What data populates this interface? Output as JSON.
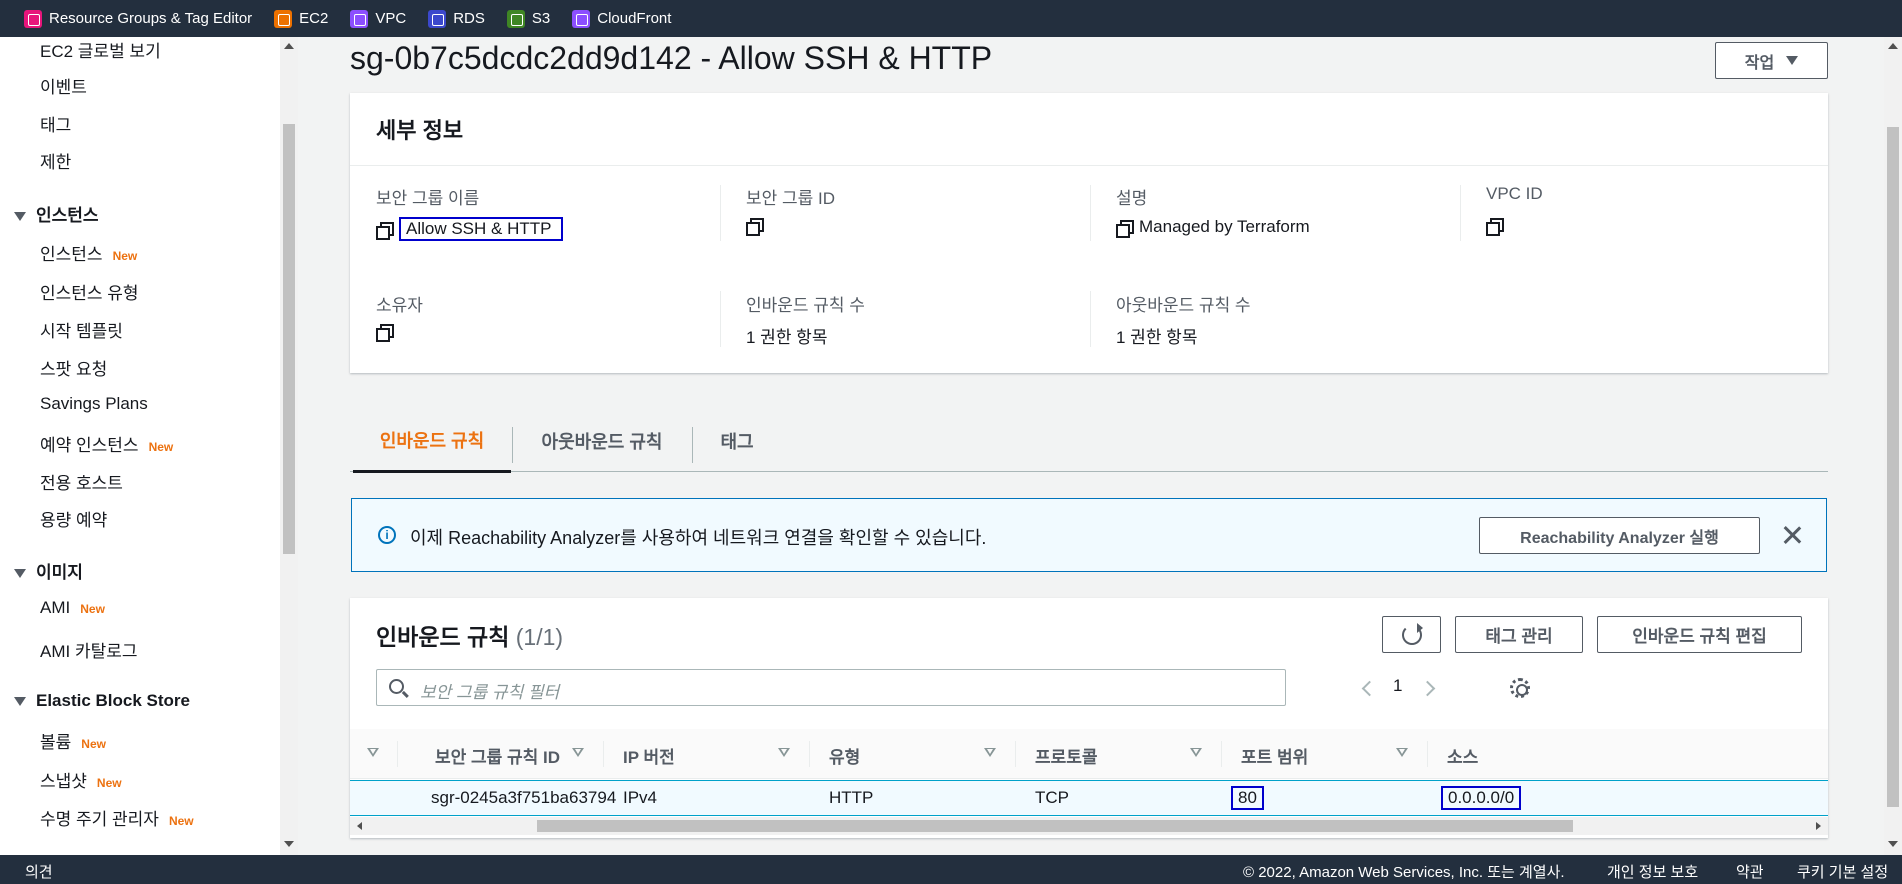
{
  "topbar": {
    "favorites": [
      {
        "label": "Resource Groups & Tag Editor",
        "color": "#e7157b"
      },
      {
        "label": "EC2",
        "color": "#ed7100"
      },
      {
        "label": "VPC",
        "color": "#8c4fff"
      },
      {
        "label": "RDS",
        "color": "#3b48cc"
      },
      {
        "label": "S3",
        "color": "#3f8624"
      },
      {
        "label": "CloudFront",
        "color": "#8c4fff"
      }
    ]
  },
  "sidebar": {
    "items_top": [
      "EC2 글로벌 보기",
      "이벤트",
      "태그",
      "제한"
    ],
    "sections": [
      {
        "title": "인스턴스",
        "items": [
          {
            "label": "인스턴스",
            "badge": "New"
          },
          {
            "label": "인스턴스 유형",
            "badge": ""
          },
          {
            "label": "시작 템플릿",
            "badge": ""
          },
          {
            "label": "스팟 요청",
            "badge": ""
          },
          {
            "label": "Savings Plans",
            "badge": ""
          },
          {
            "label": "예약 인스턴스",
            "badge": "New"
          },
          {
            "label": "전용 호스트",
            "badge": ""
          },
          {
            "label": "용량 예약",
            "badge": ""
          }
        ]
      },
      {
        "title": "이미지",
        "items": [
          {
            "label": "AMI",
            "badge": "New"
          },
          {
            "label": "AMI 카탈로그",
            "badge": ""
          }
        ]
      },
      {
        "title": "Elastic Block Store",
        "items": [
          {
            "label": "볼륨",
            "badge": "New"
          },
          {
            "label": "스냅샷",
            "badge": "New"
          },
          {
            "label": "수명 주기 관리자",
            "badge": "New"
          }
        ]
      }
    ]
  },
  "page": {
    "title": "sg-0b7c5dcdc2dd9d142 - Allow SSH & HTTP",
    "action_button": "작업"
  },
  "details": {
    "heading": "세부 정보",
    "fields": {
      "sg_name_label": "보안 그룹 이름",
      "sg_name_value": "Allow SSH & HTTP",
      "sg_id_label": "보안 그룹 ID",
      "sg_id_value": "",
      "description_label": "설명",
      "description_value": "Managed by Terraform",
      "vpc_id_label": "VPC ID",
      "vpc_id_value": "",
      "owner_label": "소유자",
      "owner_value": "",
      "inbound_count_label": "인바운드 규칙 수",
      "inbound_count_value": "1 권한 항목",
      "outbound_count_label": "아웃바운드 규칙 수",
      "outbound_count_value": "1 권한 항목"
    }
  },
  "tabs": [
    "인바운드 규칙",
    "아웃바운드 규칙",
    "태그"
  ],
  "alert": {
    "text": "이제 Reachability Analyzer를 사용하여 네트워크 연결을 확인할 수 있습니다.",
    "button": "Reachability Analyzer 실행"
  },
  "rules": {
    "title": "인바운드 규칙",
    "count": "(1/1)",
    "manage_tags_button": "태그 관리",
    "edit_button": "인바운드 규칙 편집",
    "search_placeholder": "보안 그룹 규칙 필터",
    "page_number": "1",
    "columns": [
      "보안 그룹 규칙 ID",
      "IP 버전",
      "유형",
      "프로토콜",
      "포트 범위",
      "소스"
    ],
    "rows": [
      {
        "id": "sgr-0245a3f751ba63794",
        "ip_version": "IPv4",
        "type": "HTTP",
        "protocol": "TCP",
        "port_range": "80",
        "source": "0.0.0.0/0"
      }
    ]
  },
  "footer": {
    "feedback": "의견",
    "copyright": "© 2022, Amazon Web Services, Inc. 또는 계열사.",
    "privacy": "개인 정보 보호",
    "terms": "약관",
    "cookies": "쿠키 기본 설정"
  }
}
